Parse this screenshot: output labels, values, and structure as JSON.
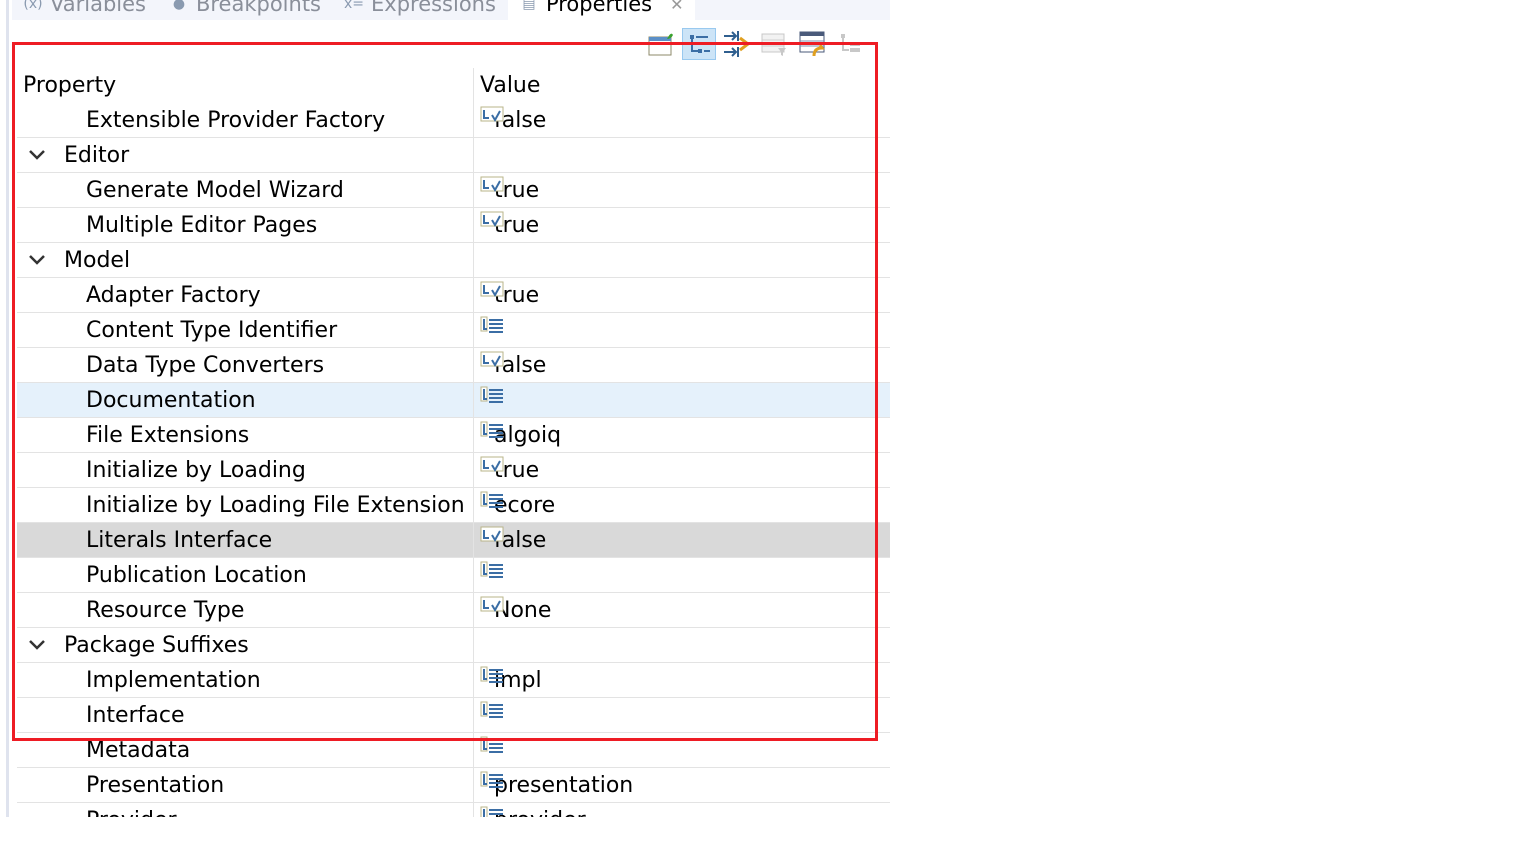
{
  "tabs": [
    {
      "label": "Variables",
      "icon": "variables-icon"
    },
    {
      "label": "Breakpoints",
      "icon": "breakpoints-icon"
    },
    {
      "label": "Expressions",
      "icon": "expressions-icon"
    },
    {
      "label": "Properties",
      "icon": "properties-icon",
      "active": true
    }
  ],
  "toolbar": [
    "pin-to-selection",
    "show-categories",
    "show-advanced-properties",
    "filter-properties",
    "restore-default-value",
    "collapse-all"
  ],
  "columns": {
    "property": "Property",
    "value": "Value"
  },
  "rows": [
    {
      "type": "prop",
      "name": "Extensible Provider Factory",
      "value": "false",
      "icon": "boolean-value-icon"
    },
    {
      "type": "cat",
      "name": "Editor"
    },
    {
      "type": "prop",
      "name": "Generate Model Wizard",
      "value": "true",
      "icon": "boolean-value-icon"
    },
    {
      "type": "prop",
      "name": "Multiple Editor Pages",
      "value": "true",
      "icon": "boolean-value-icon"
    },
    {
      "type": "cat",
      "name": "Model"
    },
    {
      "type": "prop",
      "name": "Adapter Factory",
      "value": "true",
      "icon": "boolean-value-icon"
    },
    {
      "type": "prop",
      "name": "Content Type Identifier",
      "value": "",
      "icon": "text-value-icon"
    },
    {
      "type": "prop",
      "name": "Data Type Converters",
      "value": "false",
      "icon": "boolean-value-icon"
    },
    {
      "type": "prop",
      "name": "Documentation",
      "value": "",
      "icon": "text-value-icon",
      "state": "selected"
    },
    {
      "type": "prop",
      "name": "File Extensions",
      "value": "algoiq",
      "icon": "text-value-icon"
    },
    {
      "type": "prop",
      "name": "Initialize by Loading",
      "value": "true",
      "icon": "boolean-value-icon"
    },
    {
      "type": "prop",
      "name": "Initialize by Loading File Extension",
      "value": "ecore",
      "icon": "text-value-icon"
    },
    {
      "type": "prop",
      "name": "Literals Interface",
      "value": "false",
      "icon": "boolean-value-icon",
      "state": "hover"
    },
    {
      "type": "prop",
      "name": "Publication Location",
      "value": "",
      "icon": "text-value-icon"
    },
    {
      "type": "prop",
      "name": "Resource Type",
      "value": "None",
      "icon": "boolean-value-icon"
    },
    {
      "type": "cat",
      "name": "Package Suffixes"
    },
    {
      "type": "prop",
      "name": "Implementation",
      "value": "impl",
      "icon": "text-value-icon"
    },
    {
      "type": "prop",
      "name": "Interface",
      "value": "",
      "icon": "text-value-icon"
    },
    {
      "type": "prop",
      "name": "Metadata",
      "value": "",
      "icon": "text-value-icon"
    },
    {
      "type": "prop",
      "name": "Presentation",
      "value": "presentation",
      "icon": "text-value-icon"
    },
    {
      "type": "prop",
      "name": "Provider",
      "value": "provider",
      "icon": "text-value-icon"
    }
  ],
  "colors": {
    "highlight": "#ee1c24",
    "selected": "#e5f1fb",
    "hover": "#d9d9d9"
  }
}
